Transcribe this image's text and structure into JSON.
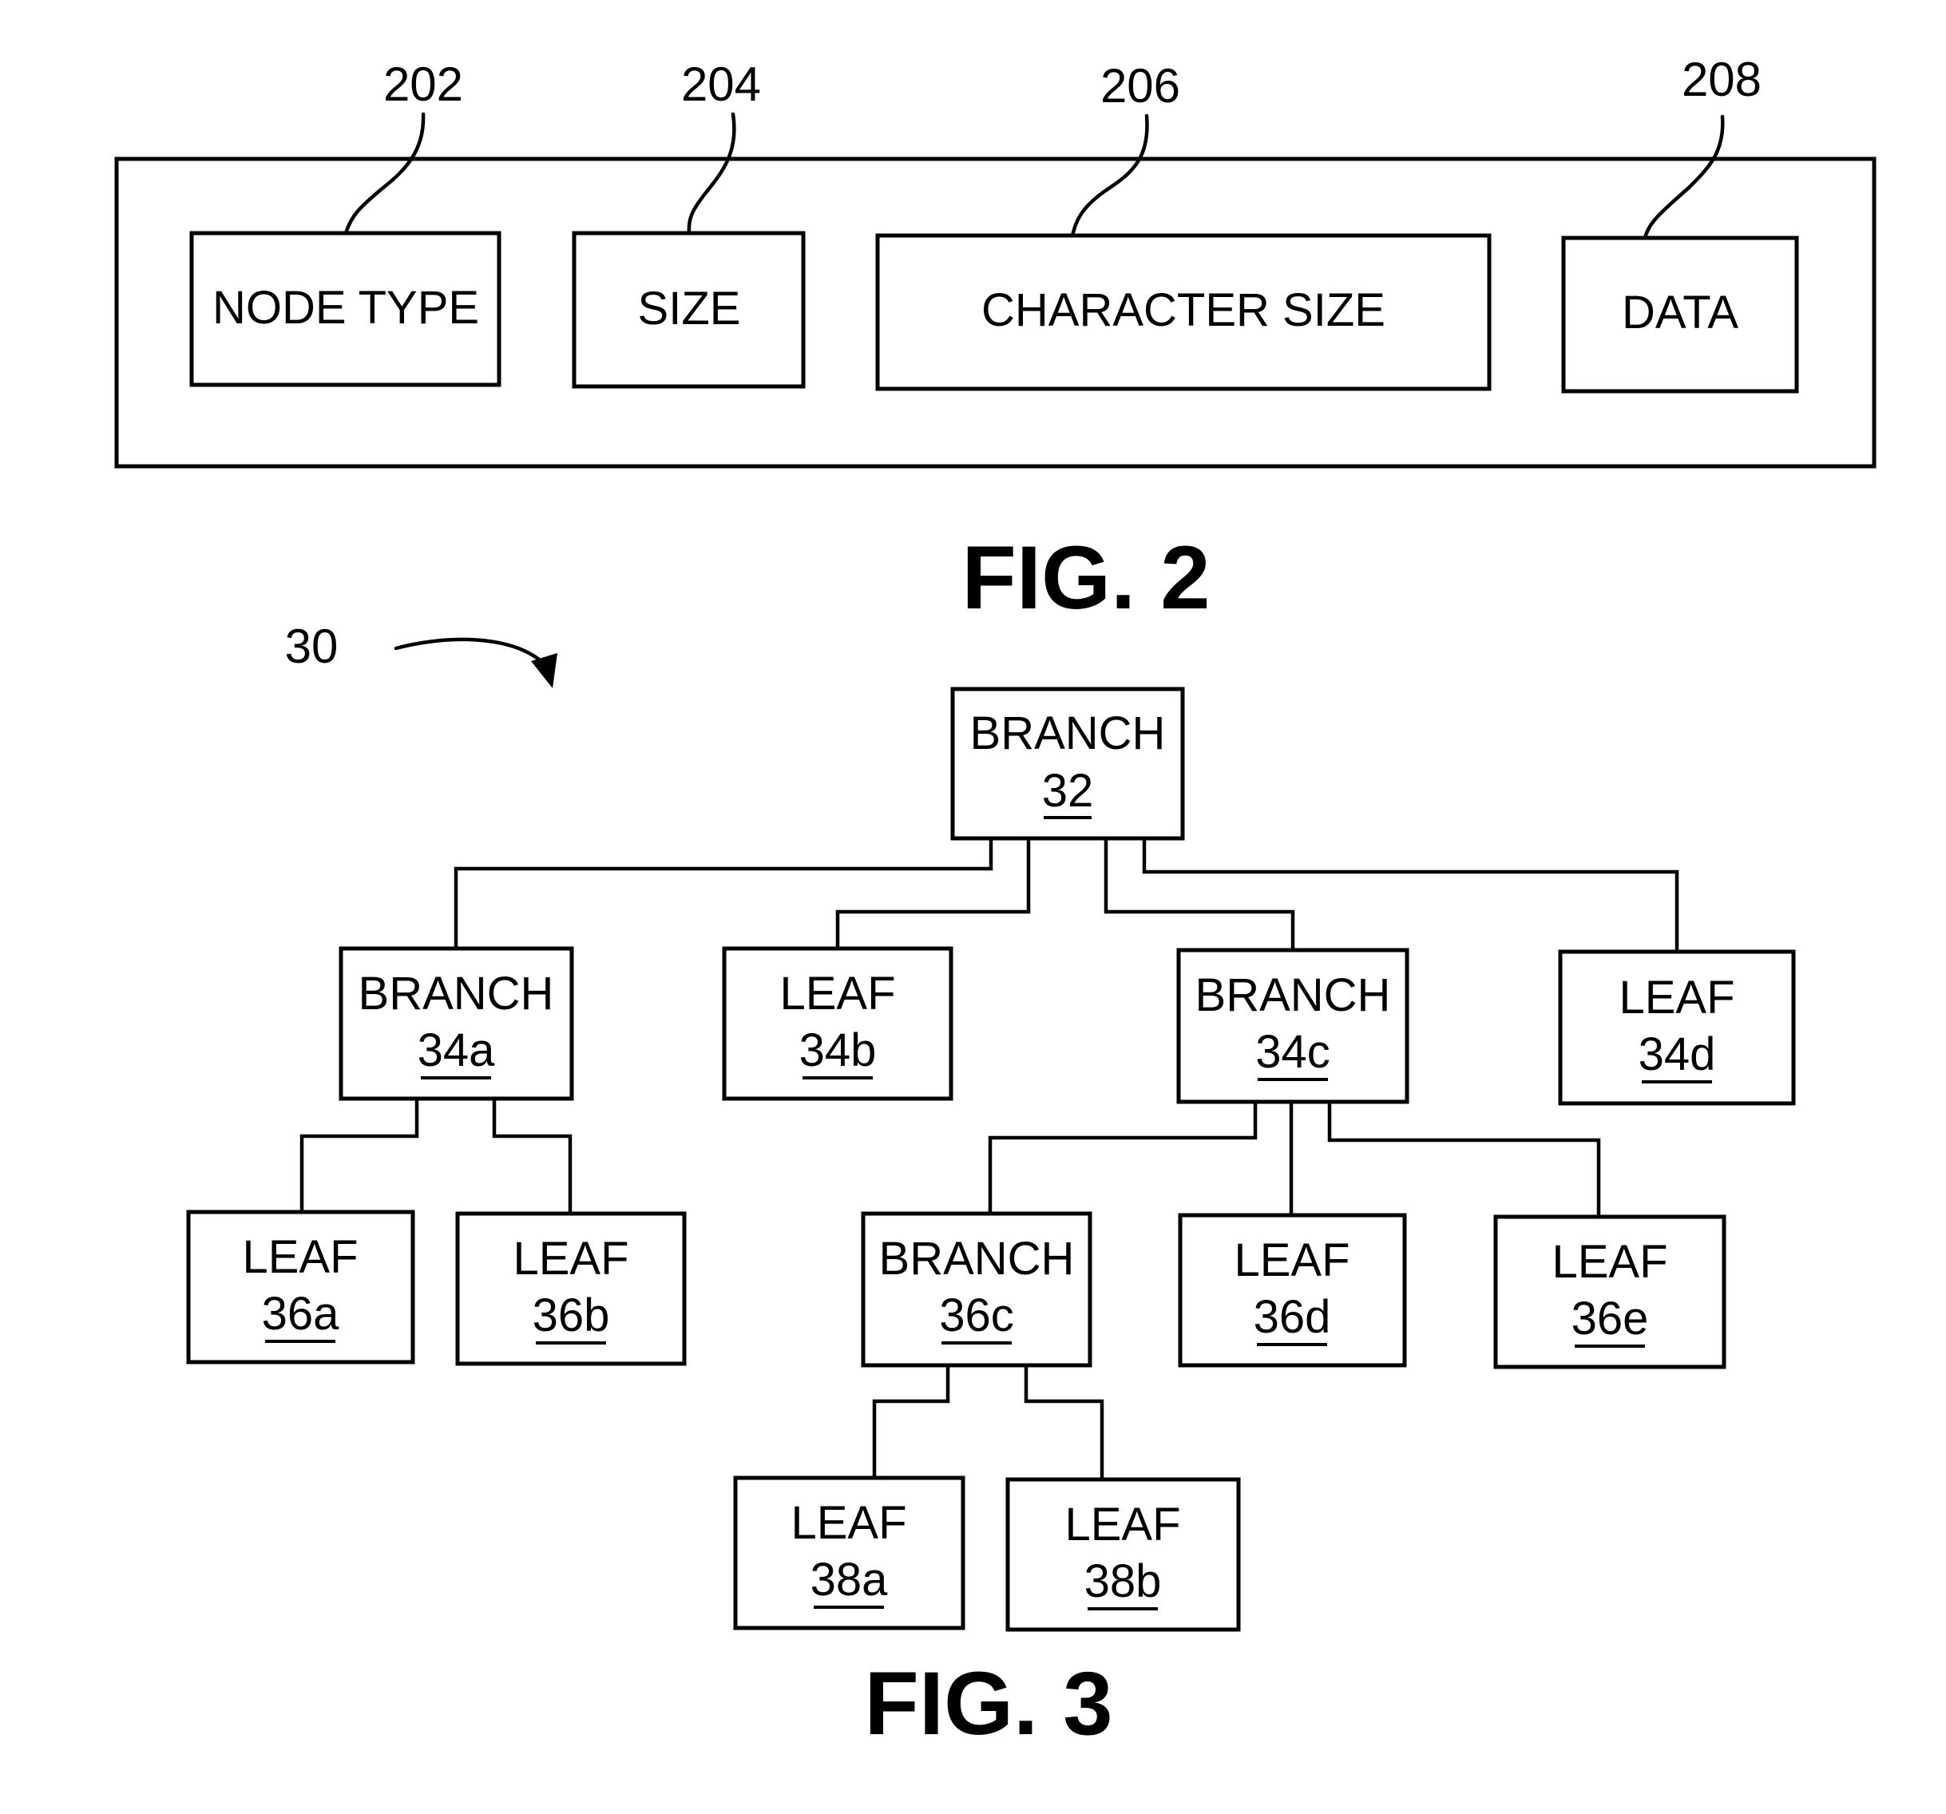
{
  "fig2": {
    "caption": "FIG. 2",
    "fields": [
      {
        "ref": "202",
        "label": "NODE TYPE"
      },
      {
        "ref": "204",
        "label": "SIZE"
      },
      {
        "ref": "206",
        "label": "CHARACTER SIZE"
      },
      {
        "ref": "208",
        "label": "DATA"
      }
    ]
  },
  "fig3": {
    "caption": "FIG. 3",
    "tree_ref": "30",
    "nodes": {
      "n32": {
        "type": "BRANCH",
        "ref": "32"
      },
      "n34a": {
        "type": "BRANCH",
        "ref": "34a"
      },
      "n34b": {
        "type": "LEAF",
        "ref": "34b"
      },
      "n34c": {
        "type": "BRANCH",
        "ref": "34c"
      },
      "n34d": {
        "type": "LEAF",
        "ref": "34d"
      },
      "n36a": {
        "type": "LEAF",
        "ref": "36a"
      },
      "n36b": {
        "type": "LEAF",
        "ref": "36b"
      },
      "n36c": {
        "type": "BRANCH",
        "ref": "36c"
      },
      "n36d": {
        "type": "LEAF",
        "ref": "36d"
      },
      "n36e": {
        "type": "LEAF",
        "ref": "36e"
      },
      "n38a": {
        "type": "LEAF",
        "ref": "38a"
      },
      "n38b": {
        "type": "LEAF",
        "ref": "38b"
      }
    },
    "edges": [
      [
        "n32",
        "n34a"
      ],
      [
        "n32",
        "n34b"
      ],
      [
        "n32",
        "n34c"
      ],
      [
        "n32",
        "n34d"
      ],
      [
        "n34a",
        "n36a"
      ],
      [
        "n34a",
        "n36b"
      ],
      [
        "n34c",
        "n36c"
      ],
      [
        "n34c",
        "n36d"
      ],
      [
        "n34c",
        "n36e"
      ],
      [
        "n36c",
        "n38a"
      ],
      [
        "n36c",
        "n38b"
      ]
    ]
  }
}
